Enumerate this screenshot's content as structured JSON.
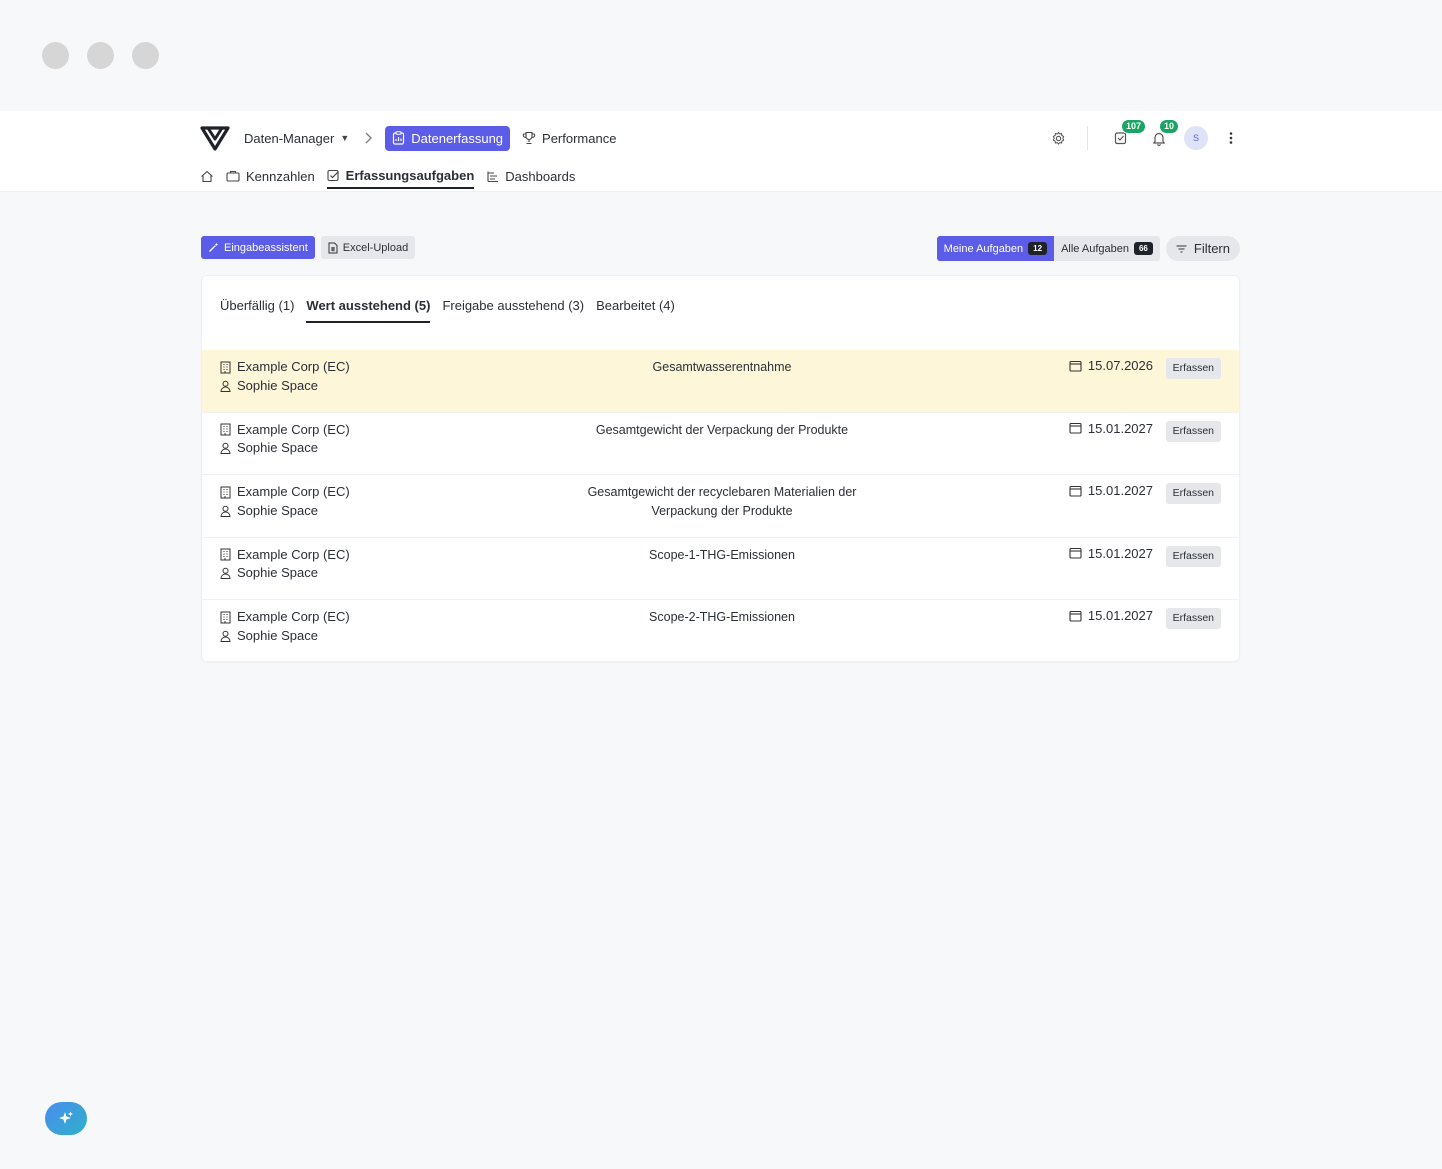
{
  "header": {
    "app_dropdown": "Daten-Manager",
    "breadcrumb_separator": ">",
    "active_module": "Datenerfassung",
    "second_module": "Performance",
    "tasks_badge": "107",
    "notifications_badge": "10",
    "avatar_initial": "S"
  },
  "subnav": {
    "items": [
      {
        "label": "Kennzahlen"
      },
      {
        "label": "Erfassungsaufgaben"
      },
      {
        "label": "Dashboards"
      }
    ]
  },
  "toolbar": {
    "assistant_label": "Eingabeassistent",
    "excel_label": "Excel-Upload",
    "my_tasks_label": "Meine Aufgaben",
    "my_tasks_count": "12",
    "all_tasks_label": "Alle Aufgaben",
    "all_tasks_count": "66",
    "filter_label": "Filtern"
  },
  "tabs": [
    {
      "label": "Überfällig (1)"
    },
    {
      "label": "Wert ausstehend (5)"
    },
    {
      "label": "Freigabe ausstehend (3)"
    },
    {
      "label": "Bearbeitet (4)"
    }
  ],
  "tasks": [
    {
      "company": "Example Corp (EC)",
      "person": "Sophie Space",
      "metric_line1": "Gesamtwasserentnahme",
      "metric_line2": "",
      "date": "15.07.2026",
      "action": "Erfassen"
    },
    {
      "company": "Example Corp (EC)",
      "person": "Sophie Space",
      "metric_line1": "Gesamtgewicht der Verpackung der Produkte",
      "metric_line2": "",
      "date": "15.01.2027",
      "action": "Erfassen"
    },
    {
      "company": "Example Corp (EC)",
      "person": "Sophie Space",
      "metric_line1": "Gesamtgewicht der recyclebaren Materialien der",
      "metric_line2": "Verpackung der Produkte",
      "date": "15.01.2027",
      "action": "Erfassen"
    },
    {
      "company": "Example Corp (EC)",
      "person": "Sophie Space",
      "metric_line1": "Scope-1-THG-Emissionen",
      "metric_line2": "",
      "date": "15.01.2027",
      "action": "Erfassen"
    },
    {
      "company": "Example Corp (EC)",
      "person": "Sophie Space",
      "metric_line1": "Scope-2-THG-Emissionen",
      "metric_line2": "",
      "date": "15.01.2027",
      "action": "Erfassen"
    }
  ],
  "colors": {
    "accent": "#5b5ce8",
    "badge": "#1aa564",
    "highlight_row": "#fdf6d8",
    "background": "#f7f8fa"
  }
}
